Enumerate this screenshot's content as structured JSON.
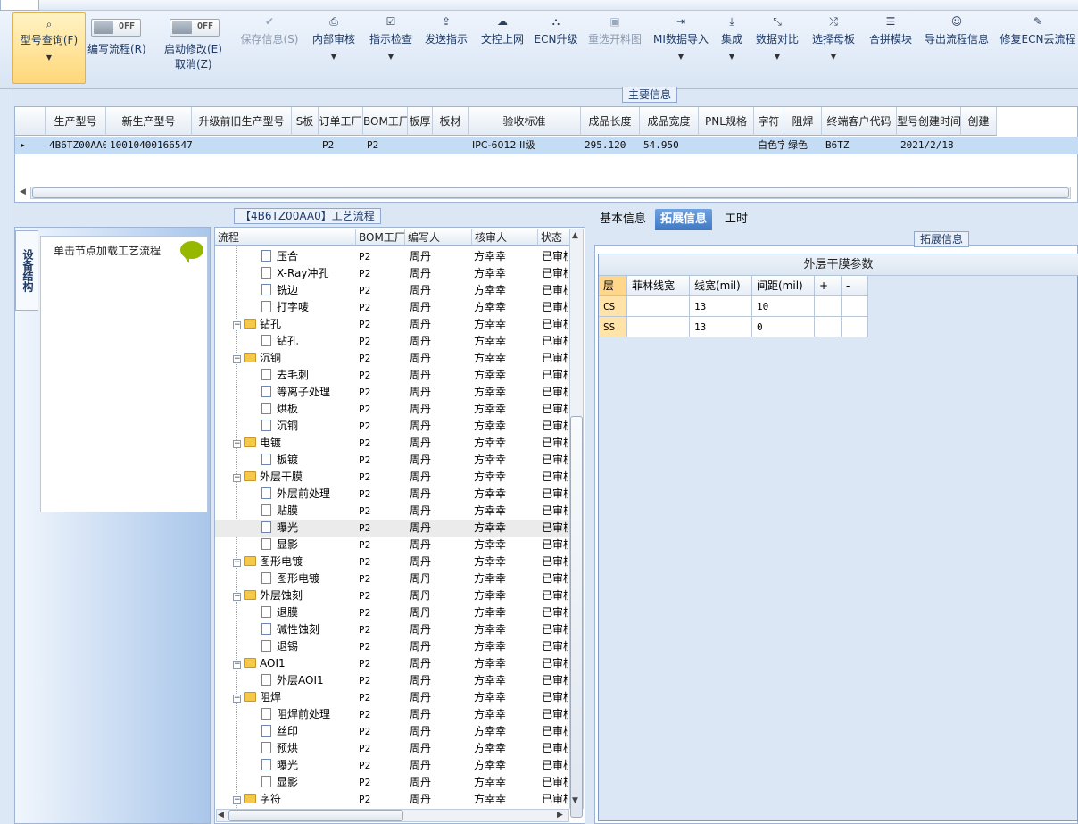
{
  "toolbar": {
    "query": {
      "label": "型号查询(F)"
    },
    "toggle1": {
      "state": "OFF",
      "label": "编写流程(R)"
    },
    "toggle2": {
      "state": "OFF",
      "label1": "启动修改(E)",
      "label2": "取消(Z)"
    },
    "buttons": [
      {
        "label": "保存信息(S)",
        "icon": "✔",
        "icon_name": "check-icon",
        "disabled": true,
        "dropdown": false
      },
      {
        "label": "内部审核",
        "icon": "⎙",
        "icon_name": "printer-icon",
        "disabled": false,
        "dropdown": true
      },
      {
        "label": "指示检查",
        "icon": "☑",
        "icon_name": "checkbox-icon",
        "disabled": false,
        "dropdown": true
      },
      {
        "label": "发送指示",
        "icon": "⇪",
        "icon_name": "upload-icon",
        "disabled": false,
        "dropdown": false
      },
      {
        "label": "文控上网",
        "icon": "☁",
        "icon_name": "cloud-upload-icon",
        "disabled": false,
        "dropdown": false
      },
      {
        "label": "ECN升级",
        "icon": "⛬",
        "icon_name": "binoculars-icon",
        "disabled": false,
        "dropdown": false
      },
      {
        "label": "重选开料图",
        "icon": "▣",
        "icon_name": "image-icon",
        "disabled": true,
        "dropdown": false
      },
      {
        "label": "MI数据导入",
        "icon": "⇥",
        "icon_name": "import-icon",
        "disabled": false,
        "dropdown": true
      },
      {
        "label": "集成",
        "icon": "⤓",
        "icon_name": "download-icon",
        "disabled": false,
        "dropdown": true
      },
      {
        "label": "数据对比",
        "icon": "⤡",
        "icon_name": "compress-icon",
        "disabled": false,
        "dropdown": true
      },
      {
        "label": "选择母板",
        "icon": "⤮",
        "icon_name": "shuffle-icon",
        "disabled": false,
        "dropdown": true
      },
      {
        "label": "合拼模块",
        "icon": "☰",
        "icon_name": "list-icon",
        "disabled": false,
        "dropdown": false
      },
      {
        "label": "导出流程信息",
        "icon": "☺",
        "icon_name": "smile-icon",
        "disabled": false,
        "dropdown": false
      },
      {
        "label": "修复ECN丢流程",
        "icon": "✎",
        "icon_name": "wrench-icon",
        "disabled": false,
        "dropdown": false
      }
    ]
  },
  "main_info": {
    "title": "主要信息",
    "columns": [
      "生产型号",
      "新生产型号",
      "升级前旧生产型号",
      "S板",
      "订单工厂",
      "BOM工厂",
      "板厚",
      "板材",
      "验收标准",
      "成品长度",
      "成品宽度",
      "PNL规格",
      "字符",
      "阻焊",
      "终端客户代码",
      "型号创建时间",
      "创建"
    ],
    "row": [
      "4B6TZ00AA0",
      "10010400166547",
      "",
      "",
      "P2",
      "P2",
      "",
      "",
      "IPC-6012 II级",
      "295.120",
      "54.950",
      "",
      "白色字符",
      "绿色",
      "B6TZ",
      "2021/2/18",
      ""
    ]
  },
  "side": {
    "tab": "设备结构",
    "hint": "单击节点加载工艺流程"
  },
  "flow": {
    "title": "【4B6TZ00AA0】工艺流程",
    "columns": [
      "流程",
      "BOM工厂",
      "编写人",
      "核审人",
      "状态"
    ],
    "rows": [
      {
        "name": "压合",
        "type": "doc",
        "level": 1,
        "factory": "P2",
        "writer": "周丹",
        "reviewer": "方幸幸",
        "status": "已审核"
      },
      {
        "name": "X-Ray冲孔",
        "type": "doc",
        "level": 1,
        "factory": "P2",
        "writer": "周丹",
        "reviewer": "方幸幸",
        "status": "已审核"
      },
      {
        "name": "铣边",
        "type": "doc",
        "level": 1,
        "factory": "P2",
        "writer": "周丹",
        "reviewer": "方幸幸",
        "status": "已审核"
      },
      {
        "name": "打字唛",
        "type": "doc",
        "level": 1,
        "factory": "P2",
        "writer": "周丹",
        "reviewer": "方幸幸",
        "status": "已审核"
      },
      {
        "name": "钻孔",
        "type": "folder",
        "level": 0,
        "factory": "P2",
        "writer": "周丹",
        "reviewer": "方幸幸",
        "status": "已审核"
      },
      {
        "name": "钻孔",
        "type": "doc",
        "level": 1,
        "factory": "P2",
        "writer": "周丹",
        "reviewer": "方幸幸",
        "status": "已审核"
      },
      {
        "name": "沉铜",
        "type": "folder",
        "level": 0,
        "factory": "P2",
        "writer": "周丹",
        "reviewer": "方幸幸",
        "status": "已审核"
      },
      {
        "name": "去毛刺",
        "type": "doc",
        "level": 1,
        "factory": "P2",
        "writer": "周丹",
        "reviewer": "方幸幸",
        "status": "已审核"
      },
      {
        "name": "等离子处理",
        "type": "doc",
        "level": 1,
        "factory": "P2",
        "writer": "周丹",
        "reviewer": "方幸幸",
        "status": "已审核"
      },
      {
        "name": "烘板",
        "type": "doc",
        "level": 1,
        "factory": "P2",
        "writer": "周丹",
        "reviewer": "方幸幸",
        "status": "已审核"
      },
      {
        "name": "沉铜",
        "type": "doc",
        "level": 1,
        "factory": "P2",
        "writer": "周丹",
        "reviewer": "方幸幸",
        "status": "已审核"
      },
      {
        "name": "电镀",
        "type": "folder",
        "level": 0,
        "factory": "P2",
        "writer": "周丹",
        "reviewer": "方幸幸",
        "status": "已审核"
      },
      {
        "name": "板镀",
        "type": "doc",
        "level": 1,
        "factory": "P2",
        "writer": "周丹",
        "reviewer": "方幸幸",
        "status": "已审核"
      },
      {
        "name": "外层干膜",
        "type": "folder",
        "level": 0,
        "factory": "P2",
        "writer": "周丹",
        "reviewer": "方幸幸",
        "status": "已审核"
      },
      {
        "name": "外层前处理",
        "type": "doc",
        "level": 1,
        "factory": "P2",
        "writer": "周丹",
        "reviewer": "方幸幸",
        "status": "已审核"
      },
      {
        "name": "贴膜",
        "type": "doc",
        "level": 1,
        "factory": "P2",
        "writer": "周丹",
        "reviewer": "方幸幸",
        "status": "已审核"
      },
      {
        "name": "曝光",
        "type": "doc",
        "level": 1,
        "factory": "P2",
        "writer": "周丹",
        "reviewer": "方幸幸",
        "status": "已审核",
        "selected": true
      },
      {
        "name": "显影",
        "type": "doc",
        "level": 1,
        "factory": "P2",
        "writer": "周丹",
        "reviewer": "方幸幸",
        "status": "已审核"
      },
      {
        "name": "图形电镀",
        "type": "folder",
        "level": 0,
        "factory": "P2",
        "writer": "周丹",
        "reviewer": "方幸幸",
        "status": "已审核"
      },
      {
        "name": "图形电镀",
        "type": "doc",
        "level": 1,
        "factory": "P2",
        "writer": "周丹",
        "reviewer": "方幸幸",
        "status": "已审核"
      },
      {
        "name": "外层蚀刻",
        "type": "folder",
        "level": 0,
        "factory": "P2",
        "writer": "周丹",
        "reviewer": "方幸幸",
        "status": "已审核"
      },
      {
        "name": "退膜",
        "type": "doc",
        "level": 1,
        "factory": "P2",
        "writer": "周丹",
        "reviewer": "方幸幸",
        "status": "已审核"
      },
      {
        "name": "碱性蚀刻",
        "type": "doc",
        "level": 1,
        "factory": "P2",
        "writer": "周丹",
        "reviewer": "方幸幸",
        "status": "已审核"
      },
      {
        "name": "退锡",
        "type": "doc",
        "level": 1,
        "factory": "P2",
        "writer": "周丹",
        "reviewer": "方幸幸",
        "status": "已审核"
      },
      {
        "name": "AOI1",
        "type": "folder",
        "level": 0,
        "factory": "P2",
        "writer": "周丹",
        "reviewer": "方幸幸",
        "status": "已审核"
      },
      {
        "name": "外层AOI1",
        "type": "doc",
        "level": 1,
        "factory": "P2",
        "writer": "周丹",
        "reviewer": "方幸幸",
        "status": "已审核"
      },
      {
        "name": "阻焊",
        "type": "folder",
        "level": 0,
        "factory": "P2",
        "writer": "周丹",
        "reviewer": "方幸幸",
        "status": "已审核"
      },
      {
        "name": "阻焊前处理",
        "type": "doc",
        "level": 1,
        "factory": "P2",
        "writer": "周丹",
        "reviewer": "方幸幸",
        "status": "已审核"
      },
      {
        "name": "丝印",
        "type": "doc",
        "level": 1,
        "factory": "P2",
        "writer": "周丹",
        "reviewer": "方幸幸",
        "status": "已审核"
      },
      {
        "name": "预烘",
        "type": "doc",
        "level": 1,
        "factory": "P2",
        "writer": "周丹",
        "reviewer": "方幸幸",
        "status": "已审核"
      },
      {
        "name": "曝光",
        "type": "doc",
        "level": 1,
        "factory": "P2",
        "writer": "周丹",
        "reviewer": "方幸幸",
        "status": "已审核"
      },
      {
        "name": "显影",
        "type": "doc",
        "level": 1,
        "factory": "P2",
        "writer": "周丹",
        "reviewer": "方幸幸",
        "status": "已审核"
      },
      {
        "name": "字符",
        "type": "folder",
        "level": 0,
        "factory": "P2",
        "writer": "周丹",
        "reviewer": "方幸幸",
        "status": "已审核"
      }
    ]
  },
  "right": {
    "tabs": [
      {
        "label": "基本信息",
        "active": false
      },
      {
        "label": "拓展信息",
        "active": true
      },
      {
        "label": "工时",
        "active": false
      }
    ],
    "group_title": "拓展信息",
    "table_title": "外层干膜参数",
    "columns": [
      "层",
      "菲林线宽",
      "线宽(mil)",
      "间距(mil)",
      "+",
      "-"
    ],
    "rows": [
      [
        "CS",
        "",
        "13",
        "10",
        "",
        ""
      ],
      [
        "SS",
        "",
        "13",
        "0",
        "",
        ""
      ]
    ]
  }
}
